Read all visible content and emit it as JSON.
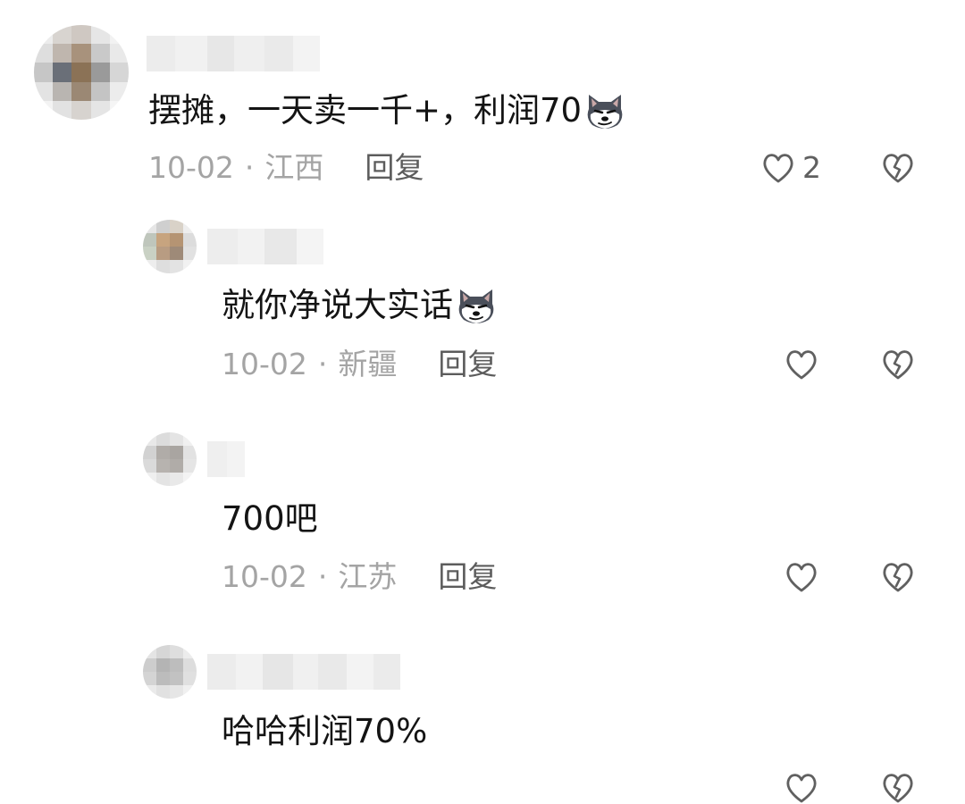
{
  "comments": [
    {
      "text": "摆摊，一天卖一千+，利润70",
      "emoji": "husky-smirk-emoji",
      "date": "10-02",
      "separator": "·",
      "location": "江西",
      "reply_label": "回复",
      "like_count": "2"
    },
    {
      "text": "就你净说大实话",
      "emoji": "husky-smirk-emoji",
      "date": "10-02",
      "separator": "·",
      "location": "新疆",
      "reply_label": "回复",
      "like_count": ""
    },
    {
      "text": "700吧",
      "date": "10-02",
      "separator": "·",
      "location": "江苏",
      "reply_label": "回复",
      "like_count": ""
    },
    {
      "text": "哈哈利润70%",
      "date": "",
      "separator": "",
      "location": "",
      "reply_label": "",
      "like_count": ""
    }
  ],
  "icons": {
    "like": "heart-outline-icon",
    "dislike": "broken-heart-icon"
  },
  "colors": {
    "text": "#141414",
    "meta": "#a4a4a4",
    "reply": "#5c5c5c",
    "icon": "#606060"
  }
}
